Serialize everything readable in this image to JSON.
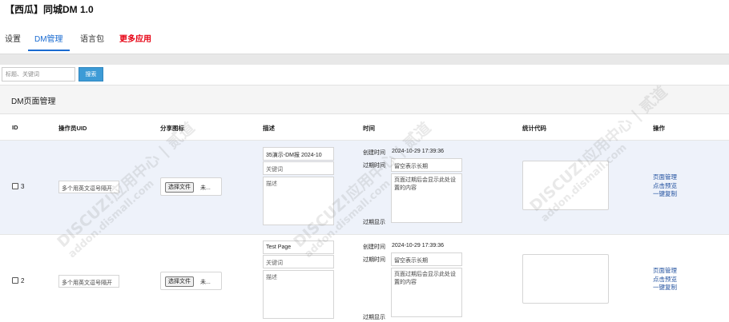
{
  "app": {
    "title": "【西瓜】同城DM 1.0"
  },
  "tabs": [
    {
      "label": "设置"
    },
    {
      "label": "DM管理"
    },
    {
      "label": "语言包"
    },
    {
      "label": "更多应用"
    }
  ],
  "search": {
    "placeholder": "标题、关键词",
    "button_label": "搜索"
  },
  "panel": {
    "title": "DM页面管理"
  },
  "table": {
    "headers": [
      "ID",
      "操作员UID",
      "分享图标",
      "描述",
      "时间",
      "统计代码",
      "操作"
    ],
    "rows": [
      {
        "id": "3",
        "uid_placeholder": "多个用英文逗号隔开",
        "file_button": "选择文件",
        "file_status": "未...",
        "title": "35演示-DM报 2024-10",
        "keyword_placeholder": "关键词",
        "desc_placeholder": "描述",
        "created_label": "创建时间",
        "created_value": "2024-10-29 17:39:36",
        "expire_label": "过期时间",
        "expire_placeholder": "留空表示长期",
        "expire_msg_placeholder": "页面过期后会显示此处设置的内容",
        "expire_show_label": "过期显示",
        "ops": [
          "页面管理",
          "点击预览",
          "一键复制"
        ]
      },
      {
        "id": "2",
        "uid_placeholder": "多个用英文逗号隔开",
        "file_button": "选择文件",
        "file_status": "未...",
        "title": "Test Page",
        "keyword_placeholder": "关键词",
        "desc_placeholder": "描述",
        "created_label": "创建时间",
        "created_value": "2024-10-29 17:39:36",
        "expire_label": "过期时间",
        "expire_placeholder": "留空表示长期",
        "expire_msg_placeholder": "页面过期后会显示此处设置的内容",
        "expire_show_label": "过期显示",
        "ops": [
          "页面管理",
          "点击预览",
          "一键复制"
        ]
      }
    ]
  },
  "watermark": {
    "line1": "DISCUZ!应用中心 | 贰道",
    "line2": "addon.dismall.com"
  },
  "colors": {
    "accent": "#1a6bd1",
    "more_apps": "#e60012",
    "search_button": "#3d9bd6",
    "row_highlight": "#eef2fa"
  }
}
